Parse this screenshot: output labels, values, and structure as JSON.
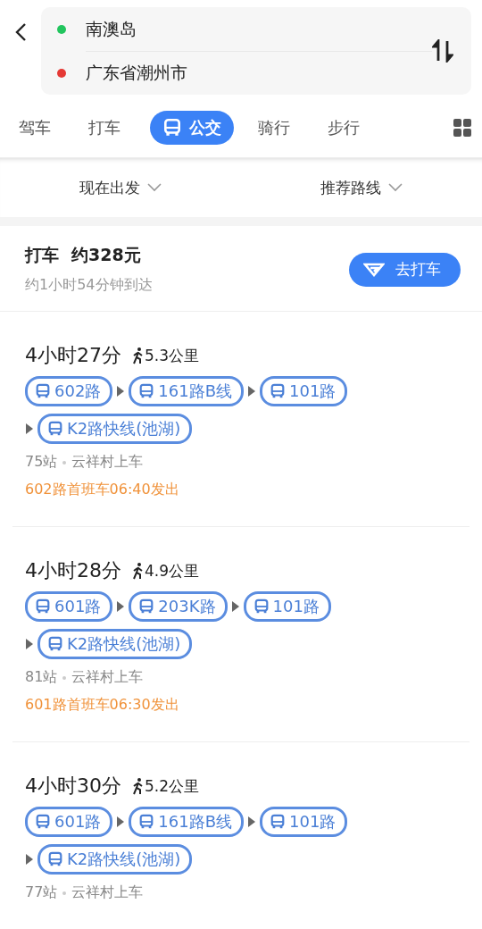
{
  "header": {
    "origin": "南澳岛",
    "destination": "广东省潮州市"
  },
  "tabs": [
    {
      "label": "驾车",
      "selected": false
    },
    {
      "label": "打车",
      "selected": false
    },
    {
      "label": "公交",
      "selected": true
    },
    {
      "label": "骑行",
      "selected": false
    },
    {
      "label": "步行",
      "selected": false
    }
  ],
  "filters": [
    {
      "label": "现在出发"
    },
    {
      "label": "推荐路线"
    }
  ],
  "taxi": {
    "title": "打车",
    "price": "约328元",
    "eta": "约1小时54分钟到达",
    "button": "去打车"
  },
  "routes": [
    {
      "duration": "4小时27分",
      "walk": "5.3公里",
      "lines": [
        "602路",
        "161路B线",
        "101路",
        "K2路快线(池湖)"
      ],
      "stops": "75站",
      "board": "云祥村上车",
      "first_bus": "602路首班车06:40发出"
    },
    {
      "duration": "4小时28分",
      "walk": "4.9公里",
      "lines": [
        "601路",
        "203K路",
        "101路",
        "K2路快线(池湖)"
      ],
      "stops": "81站",
      "board": "云祥村上车",
      "first_bus": "601路首班车06:30发出"
    },
    {
      "duration": "4小时30分",
      "walk": "5.2公里",
      "lines": [
        "601路",
        "161路B线",
        "101路",
        "K2路快线(池湖)"
      ],
      "stops": "77站",
      "board": "云祥村上车"
    }
  ]
}
